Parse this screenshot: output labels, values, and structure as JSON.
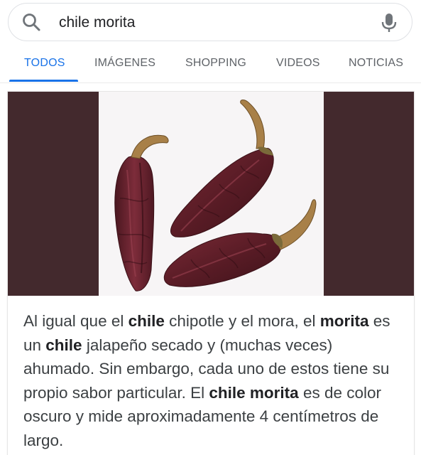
{
  "search": {
    "query": "chile morita"
  },
  "tabs": [
    {
      "label": "TODOS",
      "active": true
    },
    {
      "label": "IMÁGENES",
      "active": false
    },
    {
      "label": "SHOPPING",
      "active": false
    },
    {
      "label": "VIDEOS",
      "active": false
    },
    {
      "label": "NOTICIAS",
      "active": false
    }
  ],
  "result": {
    "snippet_parts": [
      {
        "text": "Al igual que el ",
        "bold": false
      },
      {
        "text": "chile",
        "bold": true
      },
      {
        "text": " chipotle y el mora, el ",
        "bold": false
      },
      {
        "text": "morita",
        "bold": true
      },
      {
        "text": " es un ",
        "bold": false
      },
      {
        "text": "chile",
        "bold": true
      },
      {
        "text": " jalapeño secado y (muchas veces) ahumado. Sin embargo, cada uno de estos tiene su propio sabor particular. El ",
        "bold": false
      },
      {
        "text": "chile morita",
        "bold": true
      },
      {
        "text": " es de color oscuro y mide aproximadamente 4 centímetros de largo.",
        "bold": false
      }
    ]
  },
  "colors": {
    "accent": "#1a73e8",
    "tab_inactive": "#5f6368",
    "image_band": "#43292d",
    "image_background": "#f7f5f6",
    "pepper": "#6b2430",
    "stem": "#a88048"
  },
  "icons": {
    "search": "search-icon",
    "mic": "mic-icon"
  }
}
